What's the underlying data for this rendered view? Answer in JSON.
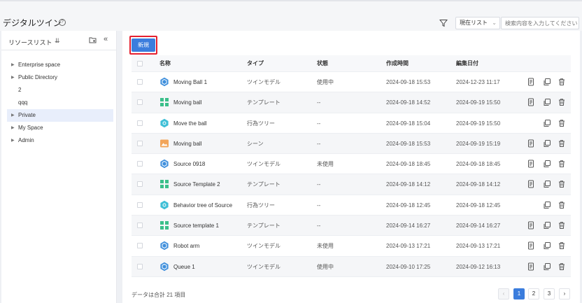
{
  "page": {
    "title": "デジタルツイン"
  },
  "filter": {
    "select_value": "現在リスト",
    "search_placeholder": "検索内容を入力してください"
  },
  "sidebar": {
    "title": "リソースリスト",
    "items": [
      {
        "label": "Enterprise space",
        "expandable": true
      },
      {
        "label": "Public Directory",
        "expandable": true
      },
      {
        "label": "2",
        "expandable": false
      },
      {
        "label": "qqq",
        "expandable": false
      },
      {
        "label": "Private",
        "expandable": true,
        "active": true
      },
      {
        "label": "My Space",
        "expandable": true
      },
      {
        "label": "Admin",
        "expandable": true
      }
    ]
  },
  "toolbar": {
    "new_label": "新規"
  },
  "table": {
    "headers": {
      "name": "名称",
      "type": "タイプ",
      "status": "状態",
      "created": "作成時間",
      "edited": "編集日付"
    },
    "rows": [
      {
        "icon": "twin-model",
        "name": "Moving Ball 1",
        "type": "ツインモデル",
        "status": "使用中",
        "created": "2024-09-18 15:53",
        "edited": "2024-12-23 11:17",
        "actions": [
          "doc",
          "copy",
          "trash"
        ]
      },
      {
        "icon": "template",
        "name": "Moving ball",
        "type": "テンプレート",
        "status": "--",
        "created": "2024-09-18 14:52",
        "edited": "2024-09-19 15:50",
        "actions": [
          "doc",
          "copy",
          "trash"
        ]
      },
      {
        "icon": "behavior-tree",
        "name": "Move the ball",
        "type": "行為ツリー",
        "status": "--",
        "created": "2024-09-18 15:04",
        "edited": "2024-09-19 15:50",
        "actions": [
          "copy",
          "trash"
        ]
      },
      {
        "icon": "scene",
        "name": "Moving ball",
        "type": "シーン",
        "status": "--",
        "created": "2024-09-18 15:53",
        "edited": "2024-09-19 15:19",
        "actions": [
          "doc",
          "copy",
          "trash"
        ]
      },
      {
        "icon": "twin-model",
        "name": "Source 0918",
        "type": "ツインモデル",
        "status": "未使用",
        "created": "2024-09-18 18:45",
        "edited": "2024-09-18 18:45",
        "actions": [
          "doc",
          "copy",
          "trash"
        ]
      },
      {
        "icon": "template",
        "name": "Source Template 2",
        "type": "テンプレート",
        "status": "--",
        "created": "2024-09-18 14:12",
        "edited": "2024-09-18 14:12",
        "actions": [
          "doc",
          "copy",
          "trash"
        ]
      },
      {
        "icon": "behavior-tree",
        "name": "Behavior tree of Source",
        "type": "行為ツリー",
        "status": "--",
        "created": "2024-09-18 12:45",
        "edited": "2024-09-18 12:45",
        "actions": [
          "copy",
          "trash"
        ]
      },
      {
        "icon": "template",
        "name": "Source template 1",
        "type": "テンプレート",
        "status": "--",
        "created": "2024-09-14 16:27",
        "edited": "2024-09-14 16:27",
        "actions": [
          "doc",
          "copy",
          "trash"
        ]
      },
      {
        "icon": "twin-model",
        "name": "Robot arm",
        "type": "ツインモデル",
        "status": "未使用",
        "created": "2024-09-13 17:21",
        "edited": "2024-09-13 17:21",
        "actions": [
          "doc",
          "copy",
          "trash"
        ]
      },
      {
        "icon": "twin-model",
        "name": "Queue 1",
        "type": "ツインモデル",
        "status": "使用中",
        "created": "2024-09-10 17:25",
        "edited": "2024-09-12 16:13",
        "actions": [
          "doc",
          "copy",
          "trash"
        ]
      }
    ]
  },
  "footer": {
    "total_text": "データは合計 21 項目",
    "pages": [
      "1",
      "2",
      "3"
    ],
    "current_page": "1"
  },
  "colors": {
    "accent": "#3b7ddd",
    "highlight_border": "#e5202e",
    "twin_model": "#3f8fdc",
    "template": "#3bbf8a",
    "behavior_tree": "#3fbfd6",
    "scene": "#f2a55a"
  }
}
